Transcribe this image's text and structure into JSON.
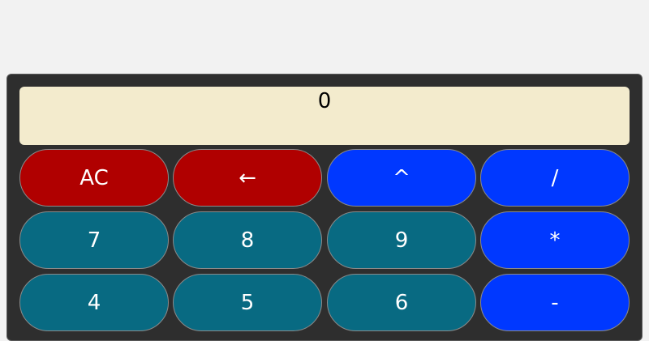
{
  "display": {
    "value": "0"
  },
  "keys": {
    "row1": [
      "AC",
      "←",
      "^",
      "/"
    ],
    "row2": [
      "7",
      "8",
      "9",
      "*"
    ],
    "row3": [
      "4",
      "5",
      "6",
      "-"
    ]
  },
  "colors": {
    "clear": "#b00000",
    "operator": "#0038ff",
    "number": "#086a82",
    "display": "#f3ebcd",
    "body": "#2e2e2e"
  }
}
